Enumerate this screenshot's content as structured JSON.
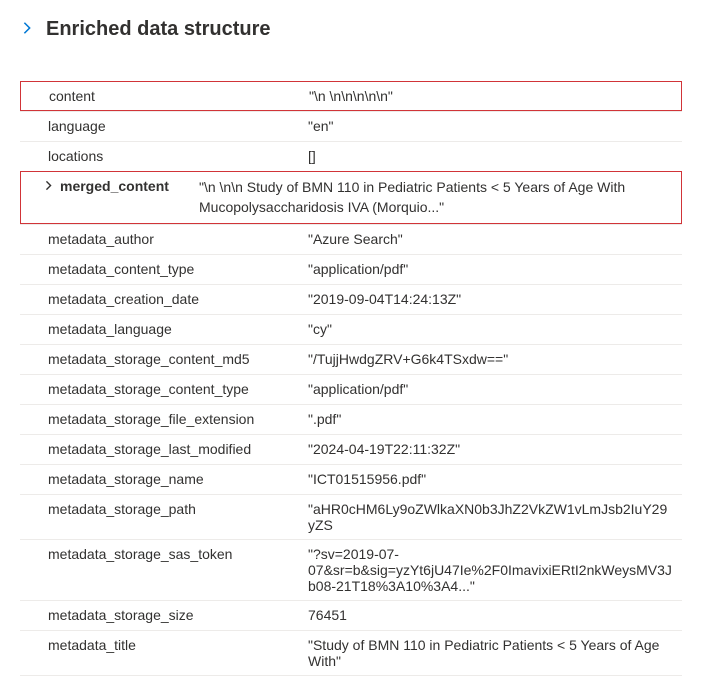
{
  "header": {
    "title": "Enriched data structure"
  },
  "rows": {
    "content": {
      "key": "content",
      "value": "\"\\n \\n\\n\\n\\n\\n\""
    },
    "language": {
      "key": "language",
      "value": "\"en\""
    },
    "locations": {
      "key": "locations",
      "value": "[]"
    },
    "merged_content": {
      "key": "merged_content",
      "value": "\"\\n \\n\\n Study of BMN 110 in Pediatric Patients < 5 Years of Age With Mucopolysaccharidosis IVA (Morquio...\""
    },
    "metadata_author": {
      "key": "metadata_author",
      "value": "\"Azure Search\""
    },
    "metadata_content_type": {
      "key": "metadata_content_type",
      "value": "\"application/pdf\""
    },
    "metadata_creation_date": {
      "key": "metadata_creation_date",
      "value": "\"2019-09-04T14:24:13Z\""
    },
    "metadata_language": {
      "key": "metadata_language",
      "value": "\"cy\""
    },
    "metadata_storage_content_md5": {
      "key": "metadata_storage_content_md5",
      "value": "\"/TujjHwdgZRV+G6k4TSxdw==\""
    },
    "metadata_storage_content_type": {
      "key": "metadata_storage_content_type",
      "value": "\"application/pdf\""
    },
    "metadata_storage_file_extension": {
      "key": "metadata_storage_file_extension",
      "value": "\".pdf\""
    },
    "metadata_storage_last_modified": {
      "key": "metadata_storage_last_modified",
      "value": "\"2024-04-19T22:11:32Z\""
    },
    "metadata_storage_name": {
      "key": "metadata_storage_name",
      "value": "\"ICT01515956.pdf\""
    },
    "metadata_storage_path": {
      "key": "metadata_storage_path",
      "value": "\"aHR0cHM6Ly9oZWlkaXN0b3JhZ2VkZW1vLmJsb2IuY29yZS"
    },
    "metadata_storage_sas_token": {
      "key": "metadata_storage_sas_token",
      "value": "\"?sv=2019-07-07&sr=b&sig=yzYt6jU47Ie%2F0ImavixiERtI2nkWeysMV3Jb08-21T18%3A10%3A4...\""
    },
    "metadata_storage_size": {
      "key": "metadata_storage_size",
      "value": "76451"
    },
    "metadata_title": {
      "key": "metadata_title",
      "value": "\"Study of BMN 110 in Pediatric Patients < 5 Years of Age With\""
    }
  }
}
